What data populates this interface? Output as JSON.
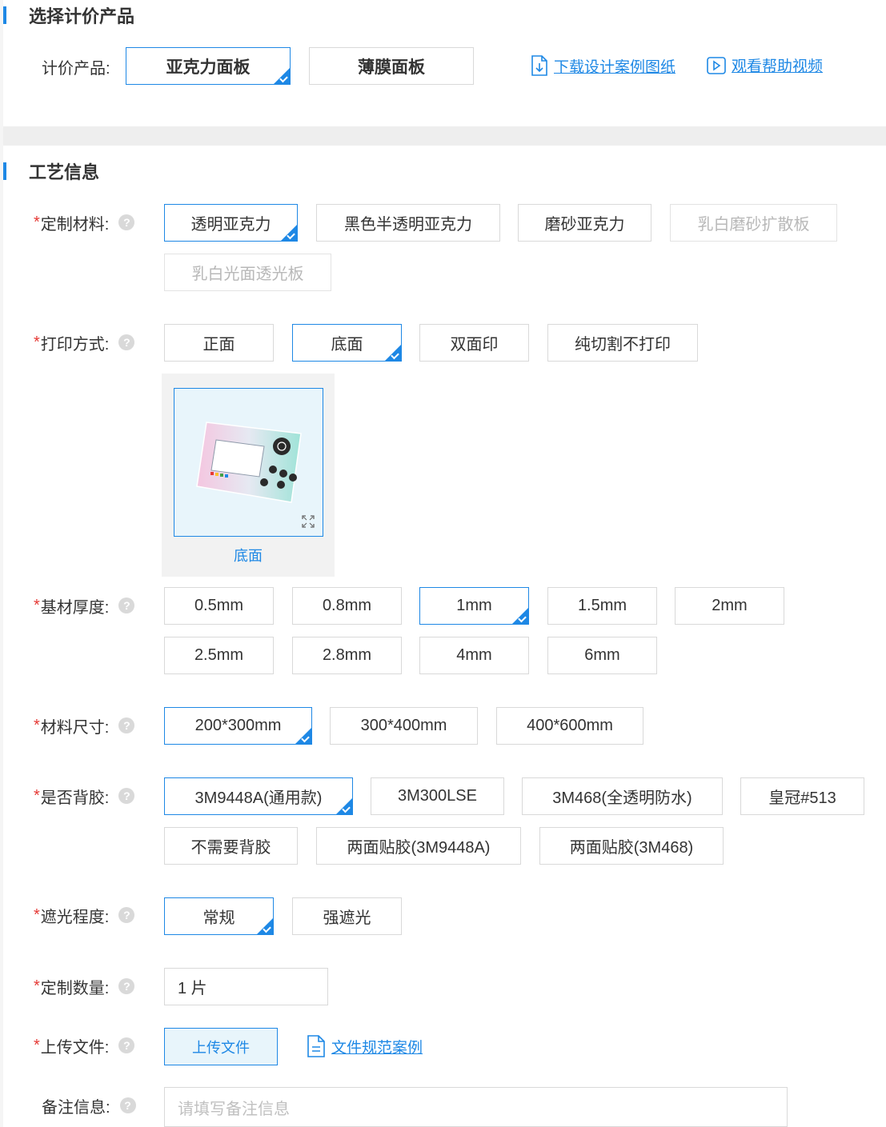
{
  "section1": {
    "title": "选择计价产品"
  },
  "product": {
    "label": "计价产品:",
    "options": [
      "亚克力面板",
      "薄膜面板"
    ],
    "selected": 0
  },
  "links": {
    "download": "下载设计案例图纸",
    "video": "观看帮助视频",
    "file_spec": "文件规范案例"
  },
  "section2": {
    "title": "工艺信息"
  },
  "material": {
    "label": "定制材料:",
    "options": [
      "透明亚克力",
      "黑色半透明亚克力",
      "磨砂亚克力",
      "乳白磨砂扩散板",
      "乳白光面透光板"
    ],
    "selected": 0,
    "disabled": [
      3,
      4
    ]
  },
  "print": {
    "label": "打印方式:",
    "options": [
      "正面",
      "底面",
      "双面印",
      "纯切割不打印"
    ],
    "selected": 1,
    "preview_caption": "底面"
  },
  "thickness": {
    "label": "基材厚度:",
    "options": [
      "0.5mm",
      "0.8mm",
      "1mm",
      "1.5mm",
      "2mm",
      "2.5mm",
      "2.8mm",
      "4mm",
      "6mm"
    ],
    "selected": 2
  },
  "size": {
    "label": "材料尺寸:",
    "options": [
      "200*300mm",
      "300*400mm",
      "400*600mm"
    ],
    "selected": 0
  },
  "adhesive": {
    "label": "是否背胶:",
    "options": [
      "3M9448A(通用款)",
      "3M300LSE",
      "3M468(全透明防水)",
      "皇冠#513",
      "不需要背胶",
      "两面贴胶(3M9448A)",
      "两面贴胶(3M468)"
    ],
    "selected": 0
  },
  "shading": {
    "label": "遮光程度:",
    "options": [
      "常规",
      "强遮光"
    ],
    "selected": 0
  },
  "quantity": {
    "label": "定制数量:",
    "value": "1 片"
  },
  "upload": {
    "label": "上传文件:",
    "button": "上传文件"
  },
  "remark": {
    "label": "备注信息:",
    "placeholder": "请填写备注信息"
  },
  "help_glyph": "?",
  "required_mark": "*",
  "colors": {
    "accent": "#1e88e5",
    "required": "#e53935",
    "border": "#d9d9d9"
  }
}
